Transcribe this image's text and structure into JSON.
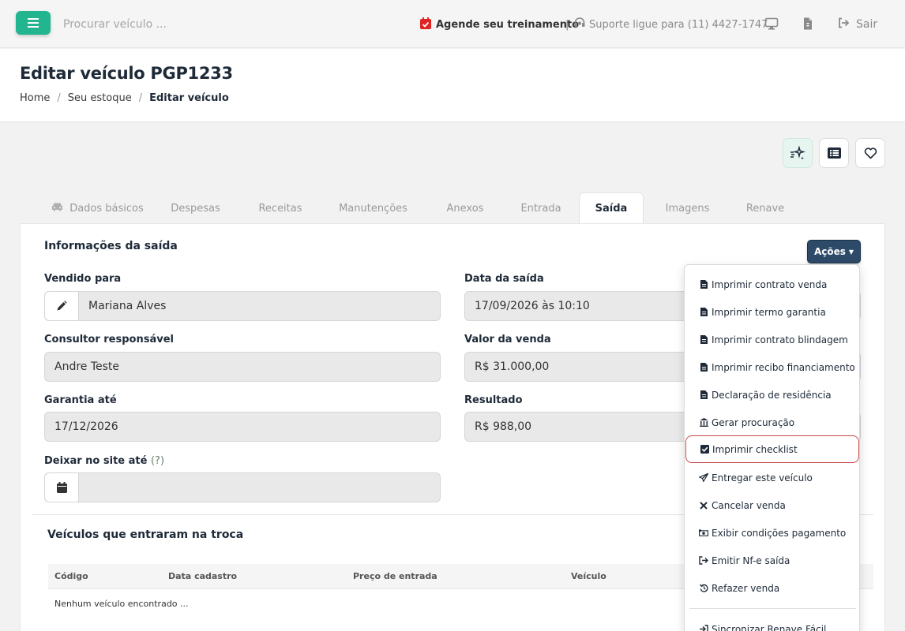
{
  "topbar": {
    "search_placeholder": "Procurar veículo ...",
    "training_label": "Agende seu treinamento",
    "separator": "|",
    "support_label": "Suporte ligue para (11) 4427-1747",
    "logout_label": "Sair"
  },
  "header": {
    "title": "Editar veículo PGP1233",
    "breadcrumb": [
      "Home",
      "Seu estoque",
      "Editar veículo"
    ]
  },
  "tabs": [
    {
      "label": "Dados básicos",
      "icon": "car-icon"
    },
    {
      "label": "Despesas"
    },
    {
      "label": "Receitas"
    },
    {
      "label": "Manutenções"
    },
    {
      "label": "Anexos"
    },
    {
      "label": "Entrada"
    },
    {
      "label": "Saída",
      "active": true
    },
    {
      "label": "Imagens"
    },
    {
      "label": "Renave"
    }
  ],
  "section": {
    "title": "Informações da saída",
    "actions_label": "Ações"
  },
  "fields": {
    "sold_to": {
      "label": "Vendido para",
      "value": "Mariana Alves"
    },
    "sale_date": {
      "label": "Data da saída",
      "value": "17/09/2026 às 10:10"
    },
    "consultant": {
      "label": "Consultor responsável",
      "value": "Andre Teste"
    },
    "sale_value": {
      "label": "Valor da venda",
      "value": "R$ 31.000,00"
    },
    "warranty": {
      "label": "Garantia até",
      "value": "17/12/2026"
    },
    "result": {
      "label": "Resultado",
      "value": "R$ 988,00"
    },
    "site_until": {
      "label": "Deixar no site até",
      "help": "(?)",
      "value": ""
    }
  },
  "trade_in": {
    "title": "Veículos que entraram na troca",
    "columns": [
      "Código",
      "Data cadastro",
      "Preço de entrada",
      "Veículo"
    ],
    "empty_text": "Nenhum veículo encontrado ..."
  },
  "dropdown": {
    "items": [
      {
        "label": "Imprimir contrato venda",
        "icon": "document-icon"
      },
      {
        "label": "Imprimir termo garantia",
        "icon": "document-icon"
      },
      {
        "label": "Imprimir contrato blindagem",
        "icon": "document-icon"
      },
      {
        "label": "Imprimir recibo financiamento",
        "icon": "document-icon"
      },
      {
        "label": "Declaração de residência",
        "icon": "document-icon"
      },
      {
        "label": "Gerar procuração",
        "icon": "bank-icon"
      },
      {
        "label": "Imprimir checklist",
        "icon": "checkbox-icon",
        "highlighted": true
      },
      {
        "label": "Entregar este veículo",
        "icon": "paper-plane-icon"
      },
      {
        "label": "Cancelar venda",
        "icon": "close-icon"
      },
      {
        "label": "Exibir condições pagamento",
        "icon": "money-icon"
      },
      {
        "label": "Emitir Nf-e saída",
        "icon": "sign-out-icon"
      },
      {
        "label": "Refazer venda",
        "icon": "history-icon"
      },
      {
        "label": "Sincronizar Renave Fácil",
        "icon": "sign-in-icon"
      }
    ]
  },
  "colors": {
    "brand_green": "#22b58f",
    "actions_button": "#2d4a68",
    "highlight_border": "#c94a4a",
    "calendar_red": "#e02424"
  }
}
